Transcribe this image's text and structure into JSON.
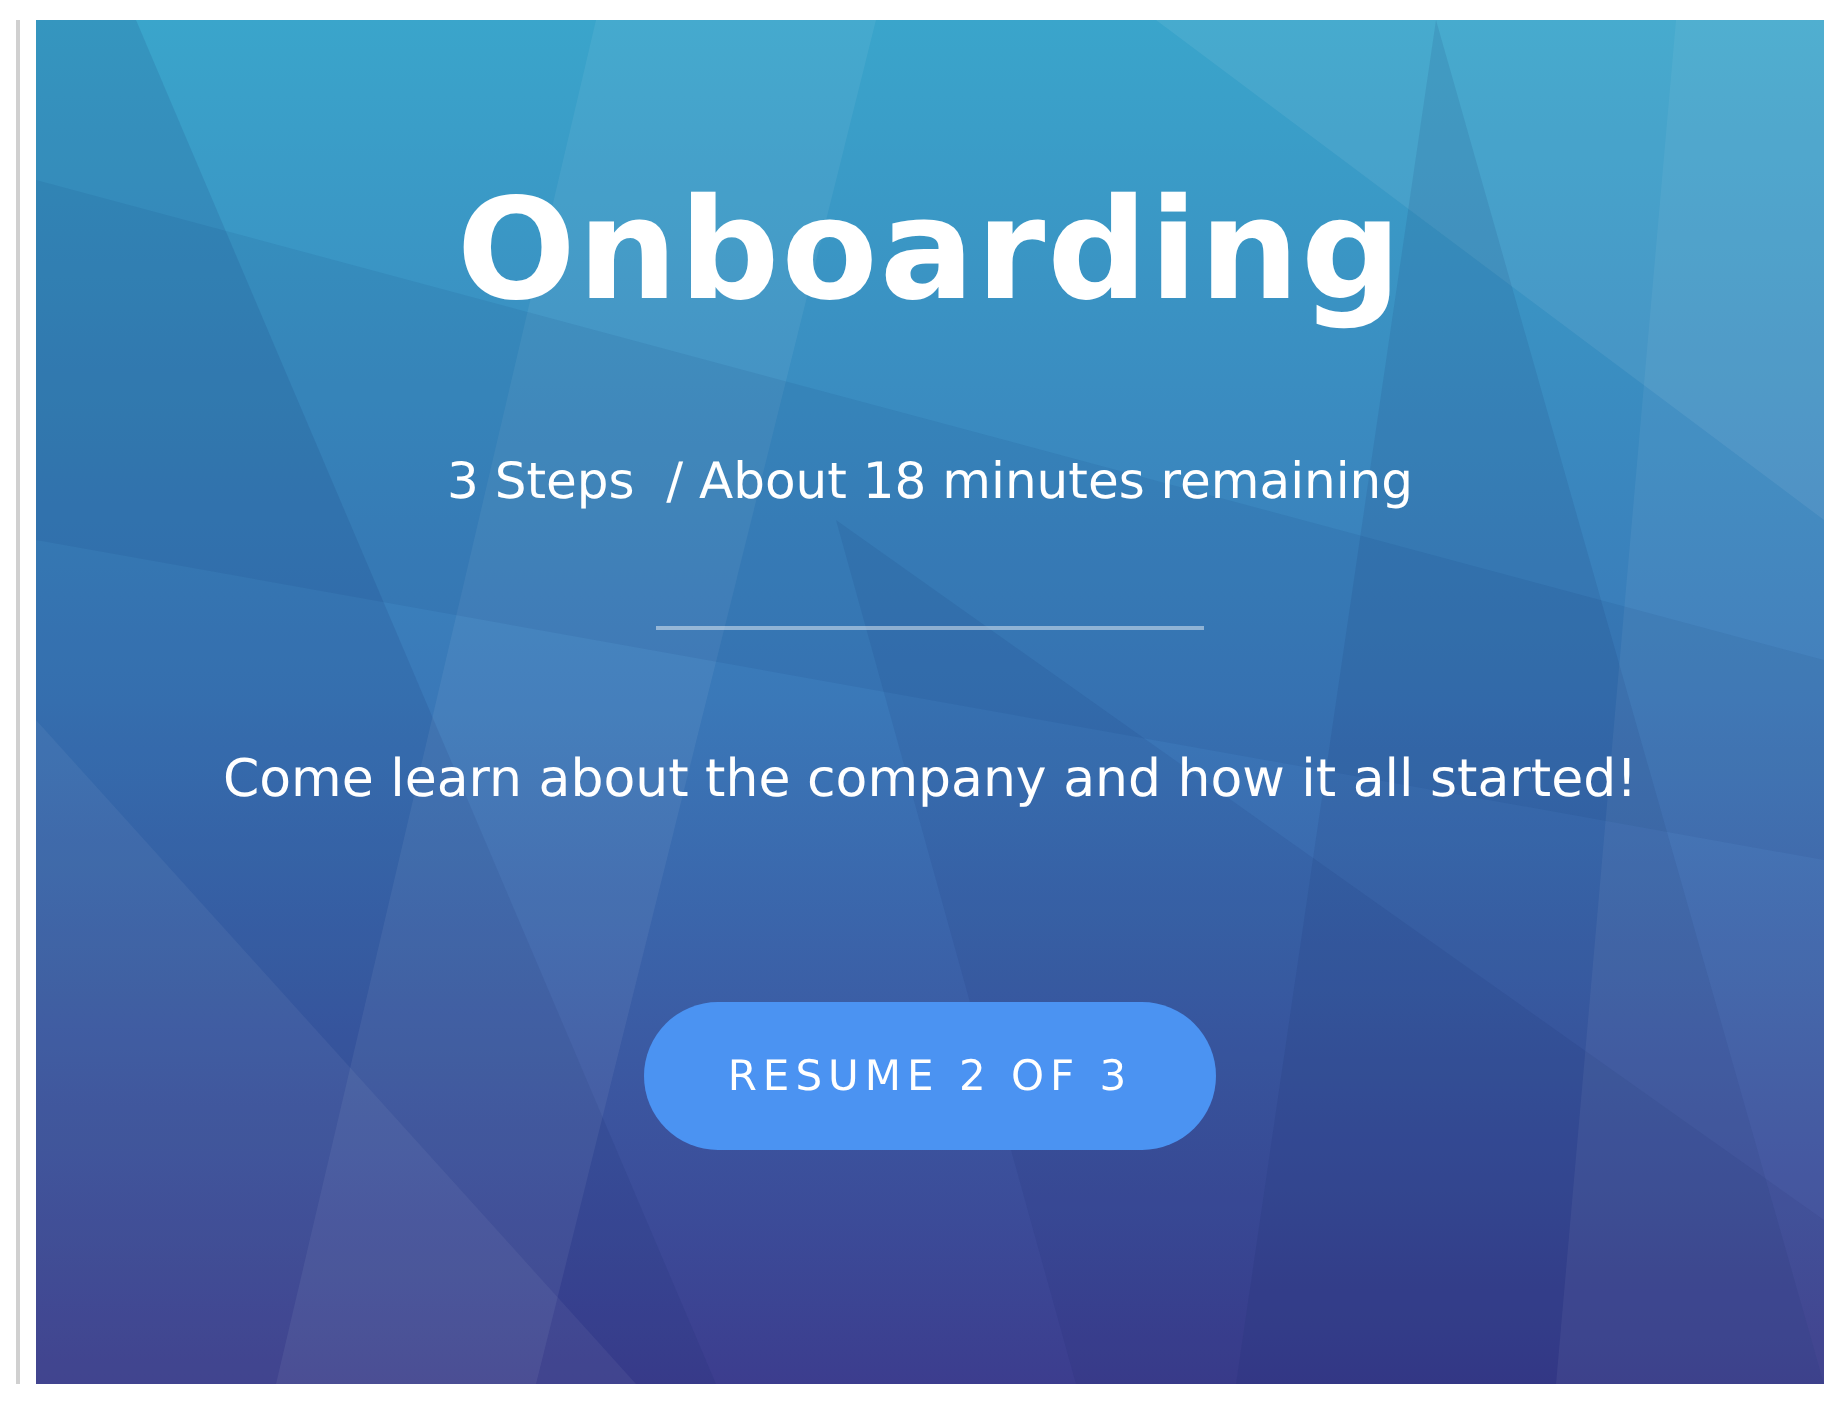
{
  "card": {
    "title": "Onboarding",
    "meta": "3 Steps  / About 18 minutes remaining",
    "description": "Come learn about the company and how it all started!",
    "button": "RESUME 2 OF 3"
  }
}
